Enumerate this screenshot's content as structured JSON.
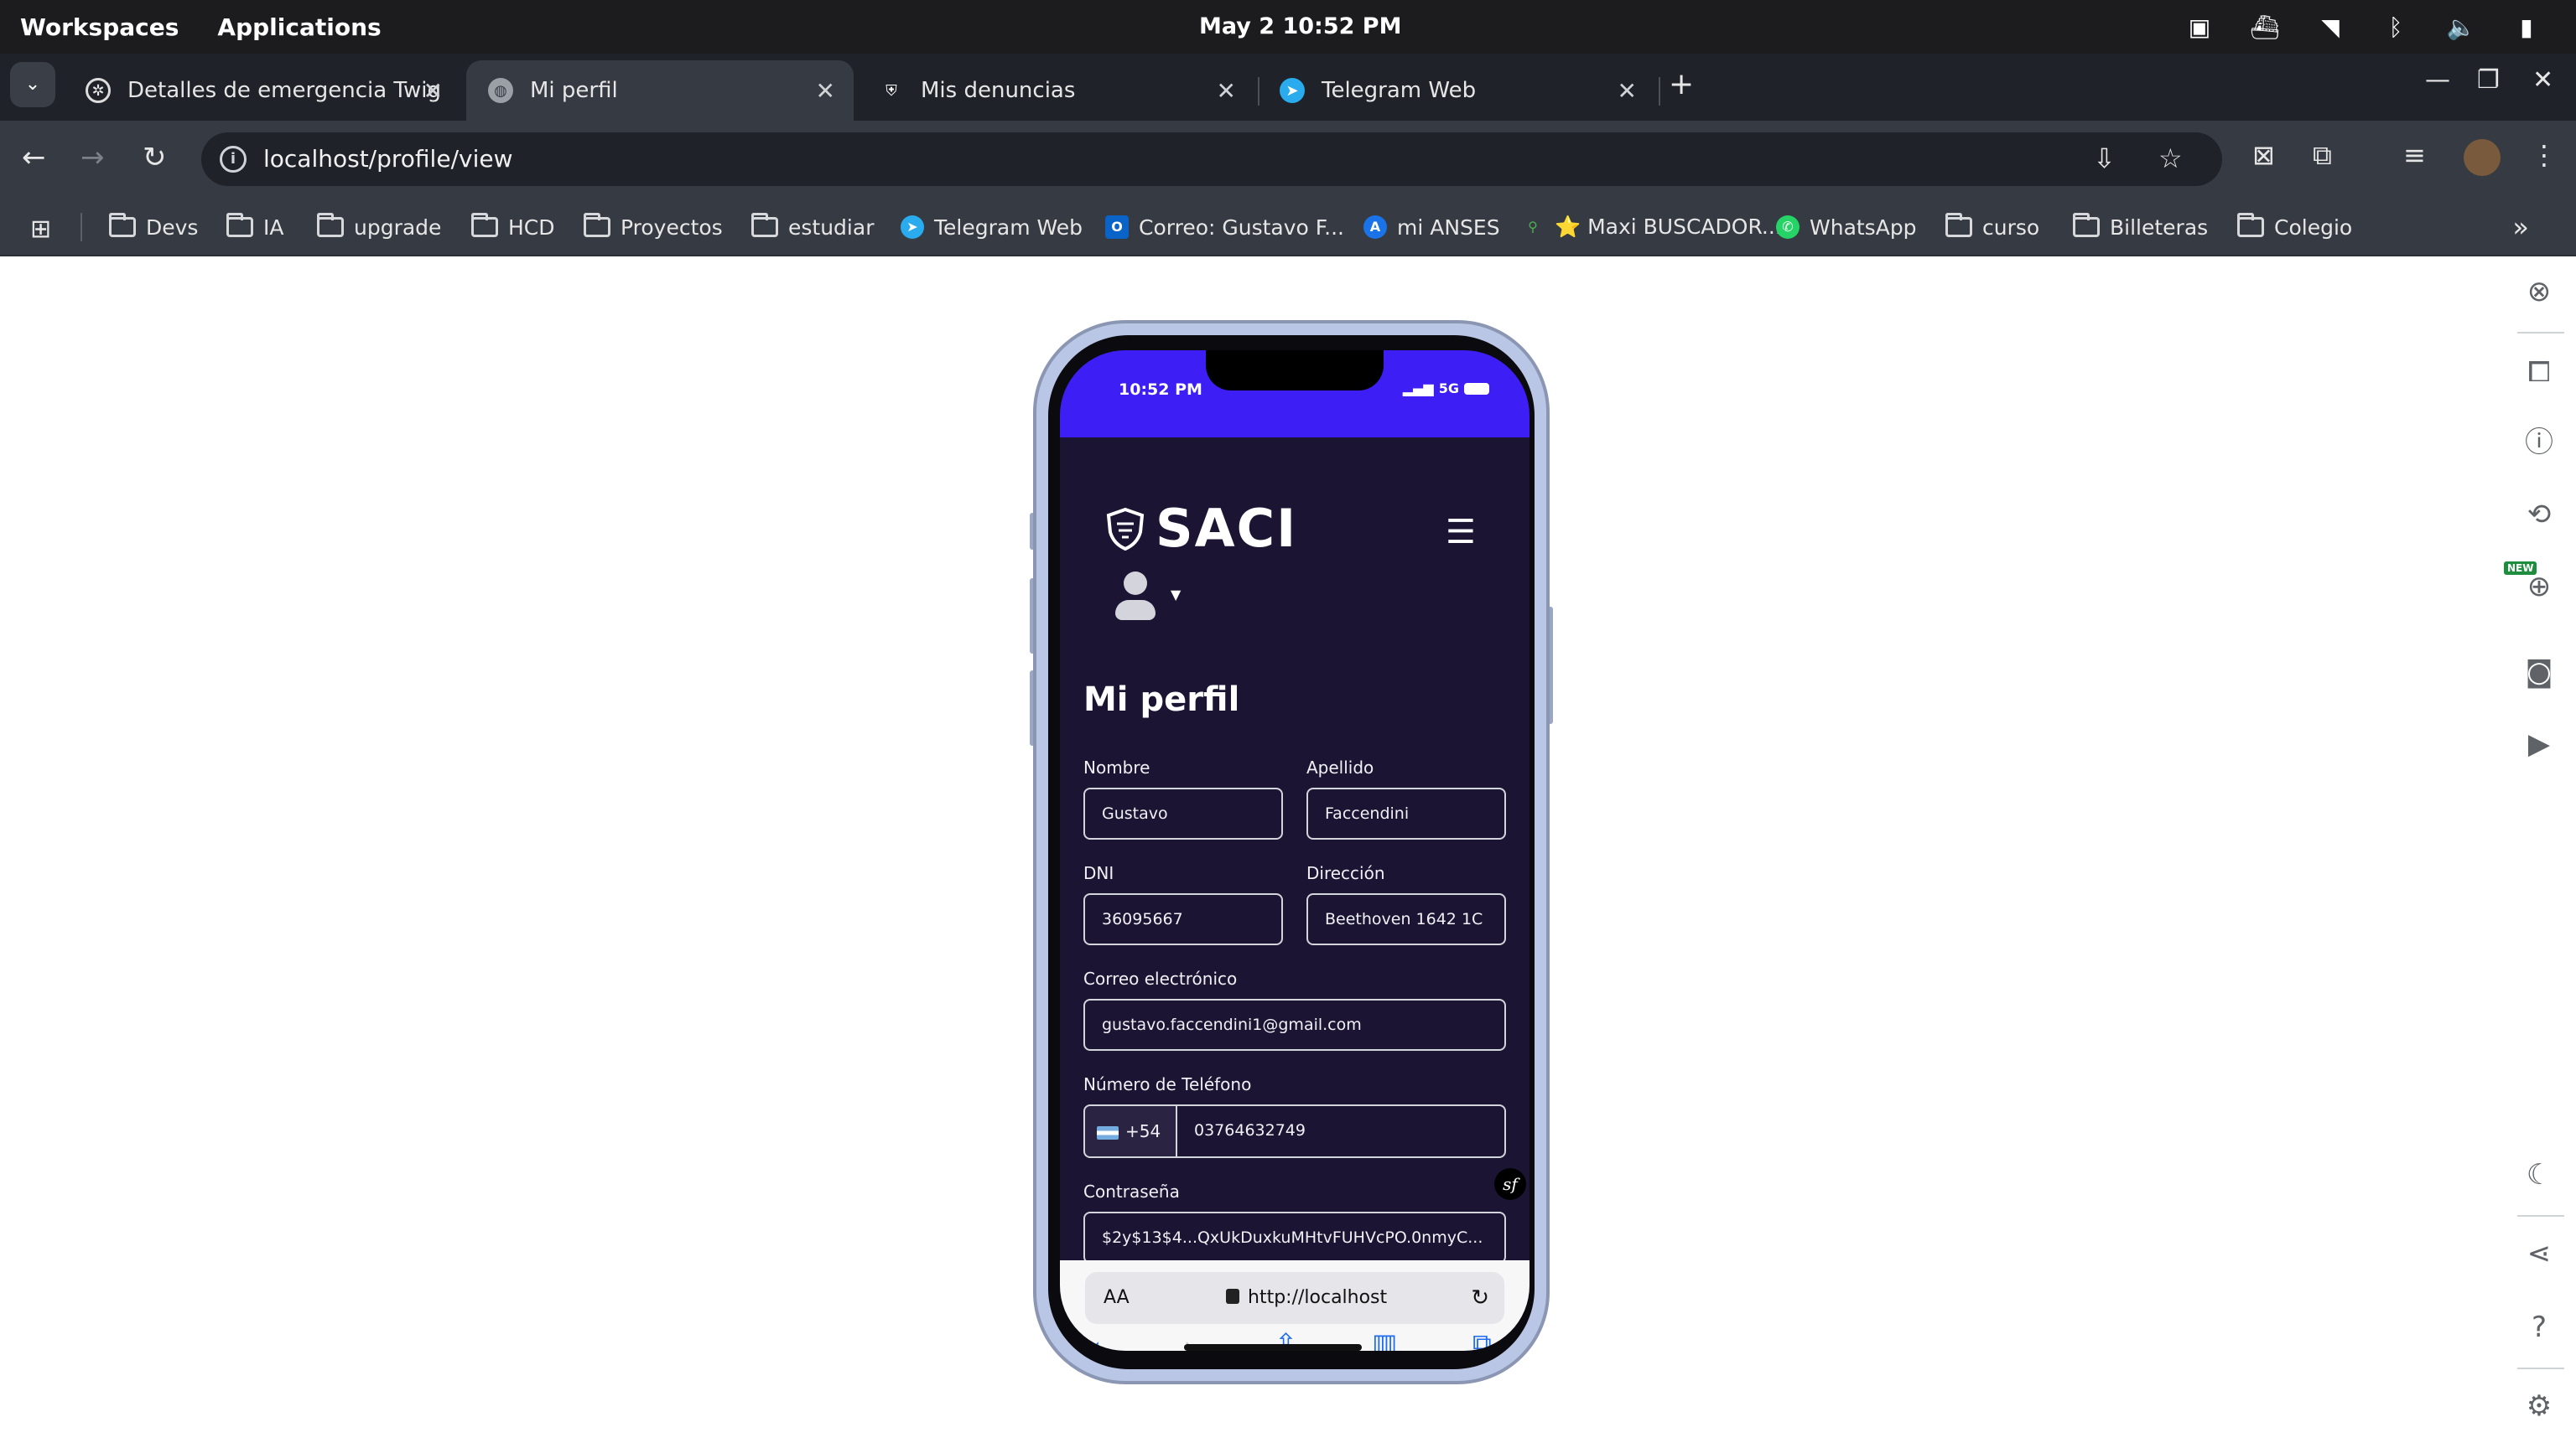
{
  "os": {
    "menu": [
      "Workspaces",
      "Applications"
    ],
    "clock": "May 2  10:52 PM"
  },
  "tabs": [
    {
      "title": "Detalles de emergencia Twig"
    },
    {
      "title": "Mi perfil"
    },
    {
      "title": "Mis denuncias"
    },
    {
      "title": "Telegram Web"
    }
  ],
  "omnibox": {
    "url": "localhost/profile/view"
  },
  "bookmarks": [
    "Devs",
    "IA",
    "upgrade",
    "HCD",
    "Proyectos",
    "estudiar",
    "Telegram Web",
    "Correo: Gustavo F...",
    "mi ANSES",
    "⭐ Maxi BUSCADOR...",
    "WhatsApp",
    "curso",
    "Billeteras",
    "Colegio"
  ],
  "phone": {
    "status_time": "10:52 PM",
    "network": "5G",
    "brand": "SACI",
    "page_title": "Mi perfil",
    "form": {
      "nombre_label": "Nombre",
      "nombre_value": "Gustavo",
      "apellido_label": "Apellido",
      "apellido_value": "Faccendini",
      "dni_label": "DNI",
      "dni_value": "36095667",
      "direccion_label": "Dirección",
      "direccion_value": "Beethoven 1642 1C",
      "email_label": "Correo electrónico",
      "email_value": "gustavo.faccendini1@gmail.com",
      "telefono_label": "Número de Teléfono",
      "telefono_prefix": "+54",
      "telefono_value": "03764632749",
      "password_label": "Contraseña",
      "password_value": "$2y$13$4...QxUkDuxkuMHtvFUHVcPO.0nmyC..."
    },
    "safari": {
      "aa": "AA",
      "url": "http://localhost"
    }
  },
  "colors": {
    "app_bg": "#1b1533",
    "status_bar": "#3d1ff5",
    "safari_link": "#1e6cf2"
  }
}
